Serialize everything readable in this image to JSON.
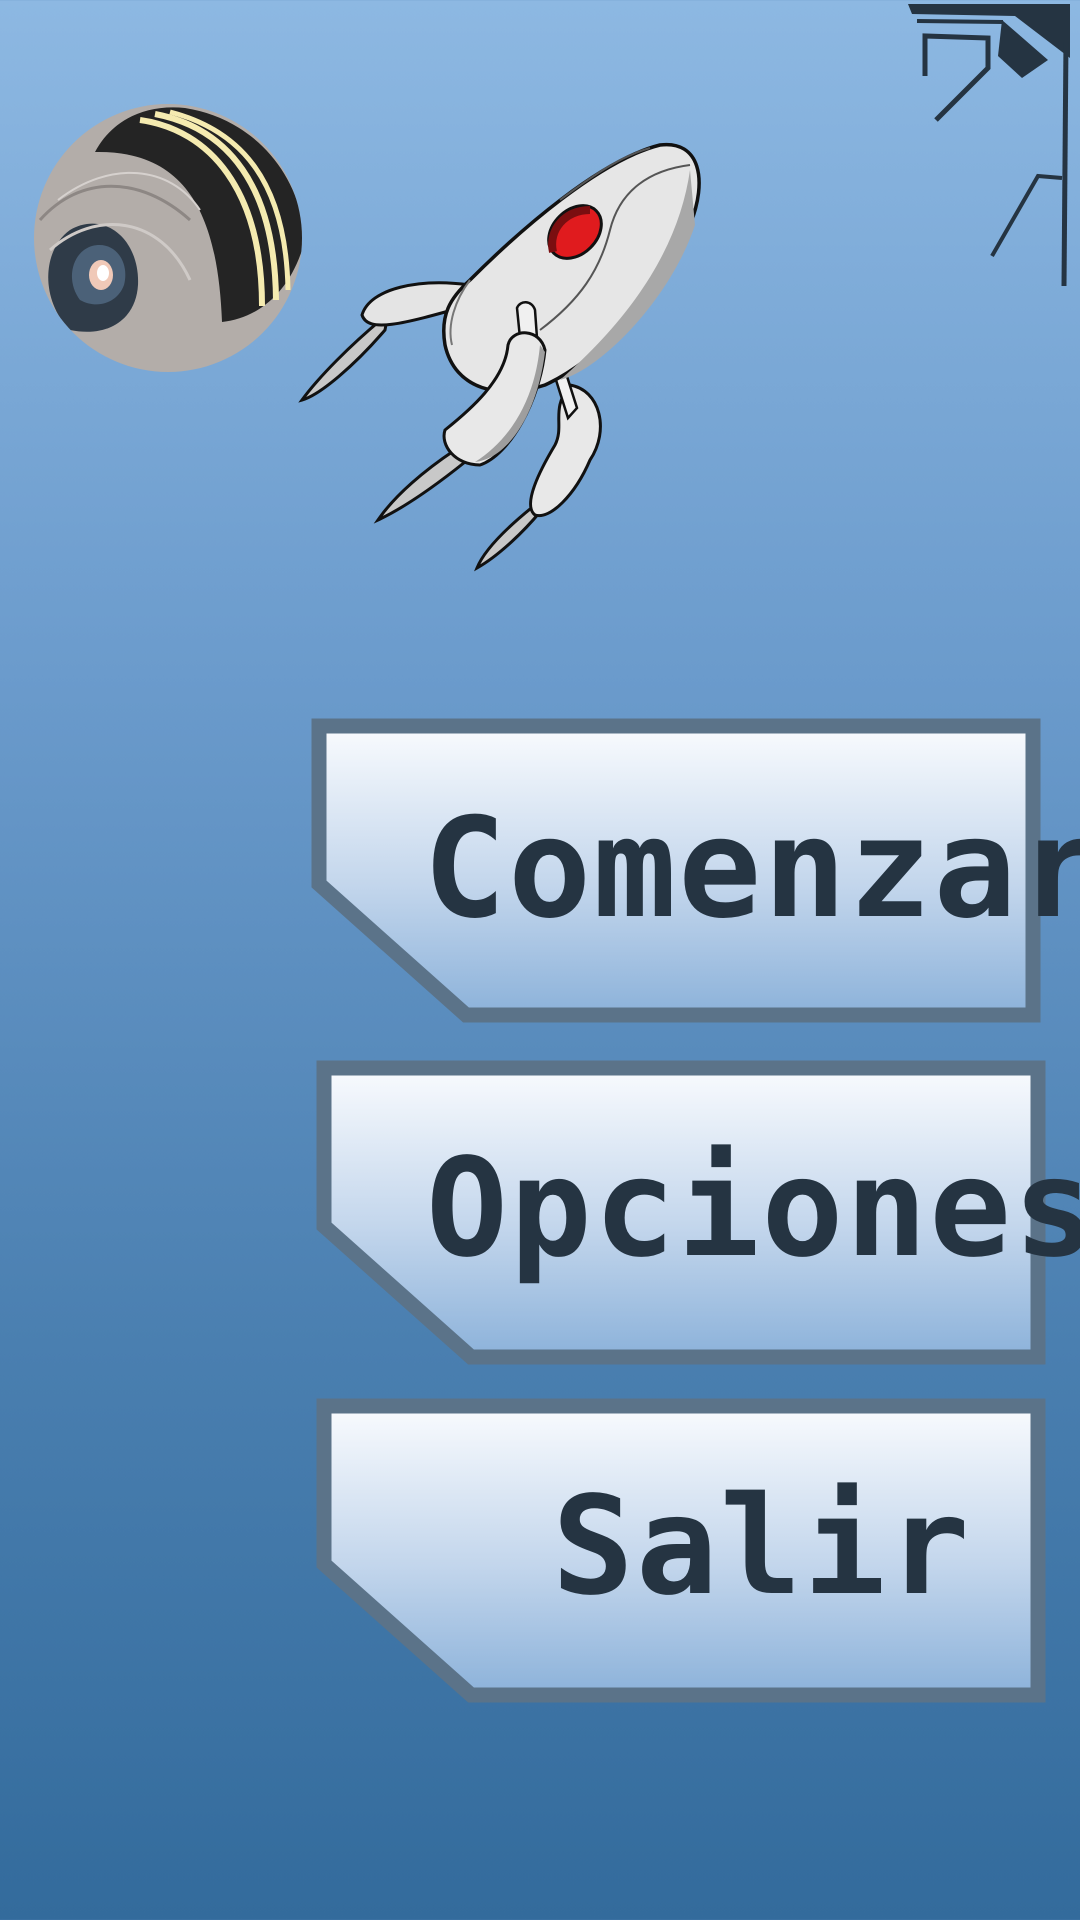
{
  "menu": {
    "start_label": "Comenzar",
    "options_label": "Opciones",
    "exit_label": "Salir"
  },
  "decorations": {
    "planet_icon": "striped-planet-icon",
    "ship_icon": "rocket-ship-icon",
    "corner_icon": "circuit-corner-icon"
  },
  "colors": {
    "bg_top": "#8db8e2",
    "bg_bottom": "#336b9c",
    "button_border": "#5b7389",
    "text": "#253442"
  }
}
